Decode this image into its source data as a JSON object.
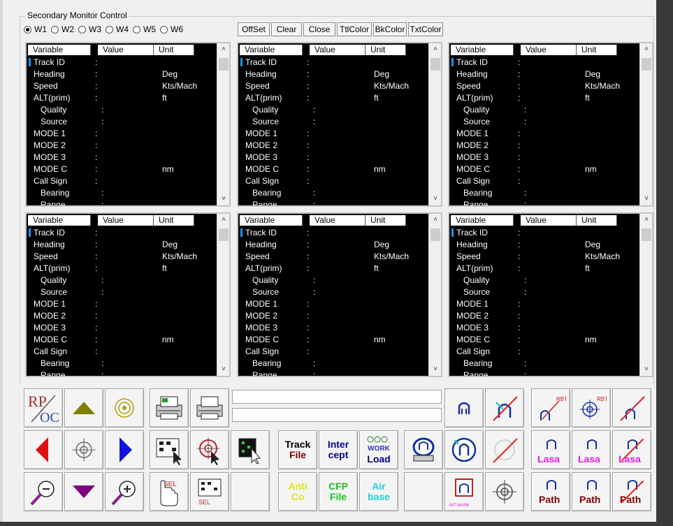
{
  "window": {
    "group_title": "Secondary Monitor Control"
  },
  "radios": [
    {
      "label": "W1",
      "selected": true
    },
    {
      "label": "W2",
      "selected": false
    },
    {
      "label": "W3",
      "selected": false
    },
    {
      "label": "W4",
      "selected": false
    },
    {
      "label": "W5",
      "selected": false
    },
    {
      "label": "W6",
      "selected": false
    }
  ],
  "toolbar": {
    "offset": "OffSet",
    "clear": "Clear",
    "close": "Close",
    "ttlcolor": "TtlColor",
    "bkcolor": "BkColor",
    "txtcolor": "TxtColor"
  },
  "panel_header": {
    "variable": "Variable",
    "value": "Value",
    "unit": "Unit"
  },
  "panel_rows": [
    {
      "label": "Track ID",
      "unit": ""
    },
    {
      "label": "Heading",
      "unit": "Deg"
    },
    {
      "label": "Speed",
      "unit": "Kts/Mach"
    },
    {
      "label": "ALT(prim)",
      "unit": "ft"
    },
    {
      "label": "Quality",
      "unit": ""
    },
    {
      "label": "Source",
      "unit": ""
    },
    {
      "label": "MODE 1",
      "unit": ""
    },
    {
      "label": "MODE 2",
      "unit": ""
    },
    {
      "label": "MODE 3",
      "unit": ""
    },
    {
      "label": "MODE C",
      "unit": "nm"
    },
    {
      "label": "Call Sign",
      "unit": ""
    },
    {
      "label": "Bearing",
      "unit": ""
    },
    {
      "label": "Range",
      "unit": ""
    }
  ],
  "tools": {
    "rpoc": "RP/OC",
    "track_file": [
      "Track",
      "File"
    ],
    "intercept": [
      "Inter",
      "cept"
    ],
    "workload": [
      "WORK",
      "Load"
    ],
    "anti_co": [
      "Anti",
      "Co"
    ],
    "cfp_file": [
      "CFP",
      "File"
    ],
    "air_base": [
      "Air",
      "base"
    ],
    "lasa": "Lasa",
    "path": "Path",
    "rbt": "RBT",
    "int_mark": "INT MARK"
  },
  "colors": {
    "panel_bg": "#000000",
    "panel_text": "#ffffff",
    "cursor": "#1e90ff",
    "arrow_red": "#e01010",
    "arrow_blue": "#1010e0",
    "arrow_olive": "#808000",
    "arrow_purple": "#800080",
    "lasa": "#e020e0",
    "path": "#800000"
  }
}
